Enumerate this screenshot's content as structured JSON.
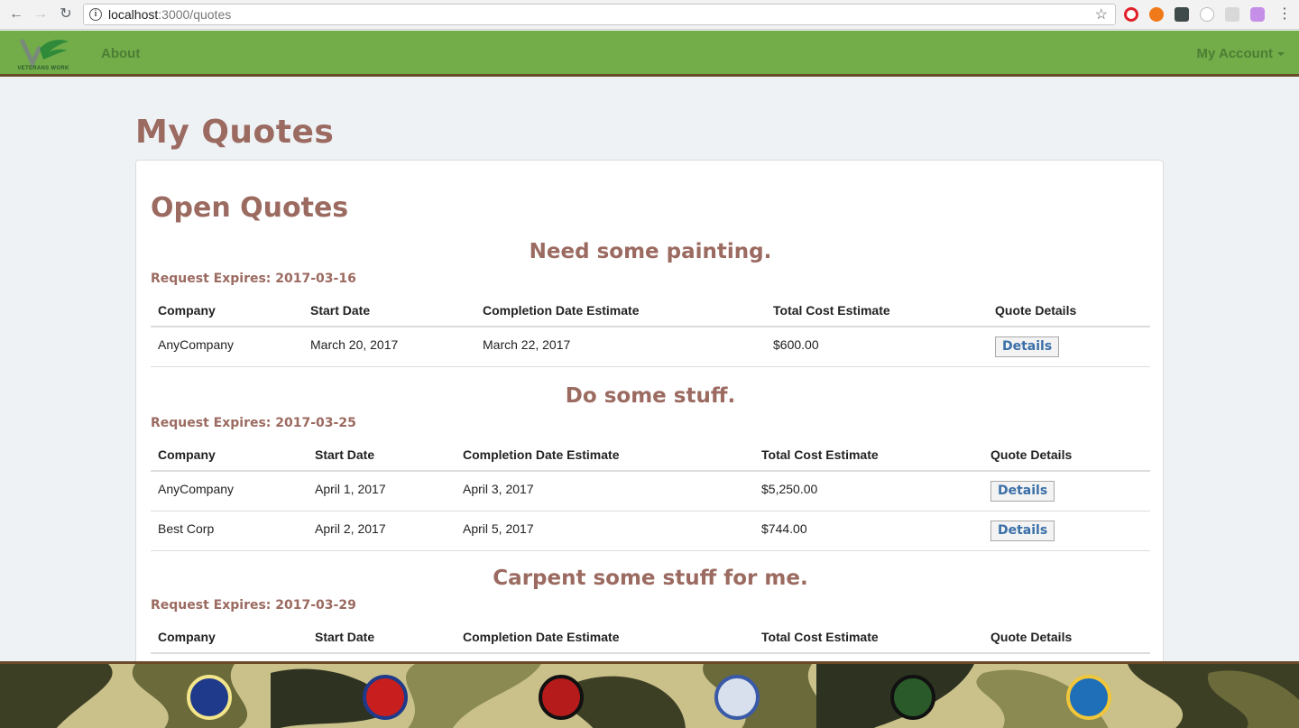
{
  "browser": {
    "url_host": "localhost",
    "url_path": ":3000/quotes"
  },
  "navbar": {
    "logo_text": "VETERANS WORK",
    "about_label": "About",
    "account_label": "My Account"
  },
  "page": {
    "title": "My Quotes",
    "section_title": "Open Quotes",
    "columns": [
      "Company",
      "Start Date",
      "Completion Date Estimate",
      "Total Cost Estimate",
      "Quote Details"
    ],
    "expires_label": "Request Expires:",
    "details_label": "Details"
  },
  "quotes": [
    {
      "title": "Need some painting.",
      "expires": "2017-03-16",
      "rows": [
        {
          "company": "AnyCompany",
          "start": "March 20, 2017",
          "completion": "March 22, 2017",
          "cost": "$600.00"
        }
      ]
    },
    {
      "title": "Do some stuff.",
      "expires": "2017-03-25",
      "rows": [
        {
          "company": "AnyCompany",
          "start": "April 1, 2017",
          "completion": "April 3, 2017",
          "cost": "$5,250.00"
        },
        {
          "company": "Best Corp",
          "start": "April 2, 2017",
          "completion": "April 5, 2017",
          "cost": "$744.00"
        }
      ]
    },
    {
      "title": "Carpent some stuff for me.",
      "expires": "2017-03-29",
      "rows": []
    }
  ],
  "colors": {
    "navbar": "#72ad4a",
    "heading": "#9b6a60",
    "link": "#3a6fa8"
  },
  "footer": {
    "seals": [
      "air-force-seal",
      "national-guard-seal",
      "marine-corps-seal",
      "navy-seal",
      "army-seal",
      "coast-guard-seal"
    ]
  }
}
